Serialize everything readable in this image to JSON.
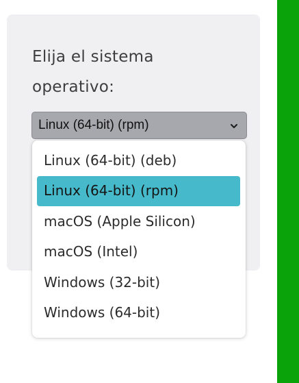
{
  "prompt": {
    "line1": "Elija el sistema",
    "line2": "operativo:"
  },
  "select": {
    "value": "Linux (64-bit) (rpm)",
    "icon": "chevron-down-icon"
  },
  "options": [
    {
      "label": "Linux (64-bit) (deb)",
      "selected": false
    },
    {
      "label": "Linux (64-bit) (rpm)",
      "selected": true
    },
    {
      "label": "macOS (Apple Silicon)",
      "selected": false
    },
    {
      "label": "macOS (Intel)",
      "selected": false
    },
    {
      "label": "Windows (32-bit)",
      "selected": false
    },
    {
      "label": "Windows (64-bit)",
      "selected": false
    }
  ],
  "colors": {
    "panel_background": "#f0f0f2",
    "select_background": "#a7a7ae",
    "selected_option": "#46bacb",
    "accent_green": "#0aa40a"
  }
}
